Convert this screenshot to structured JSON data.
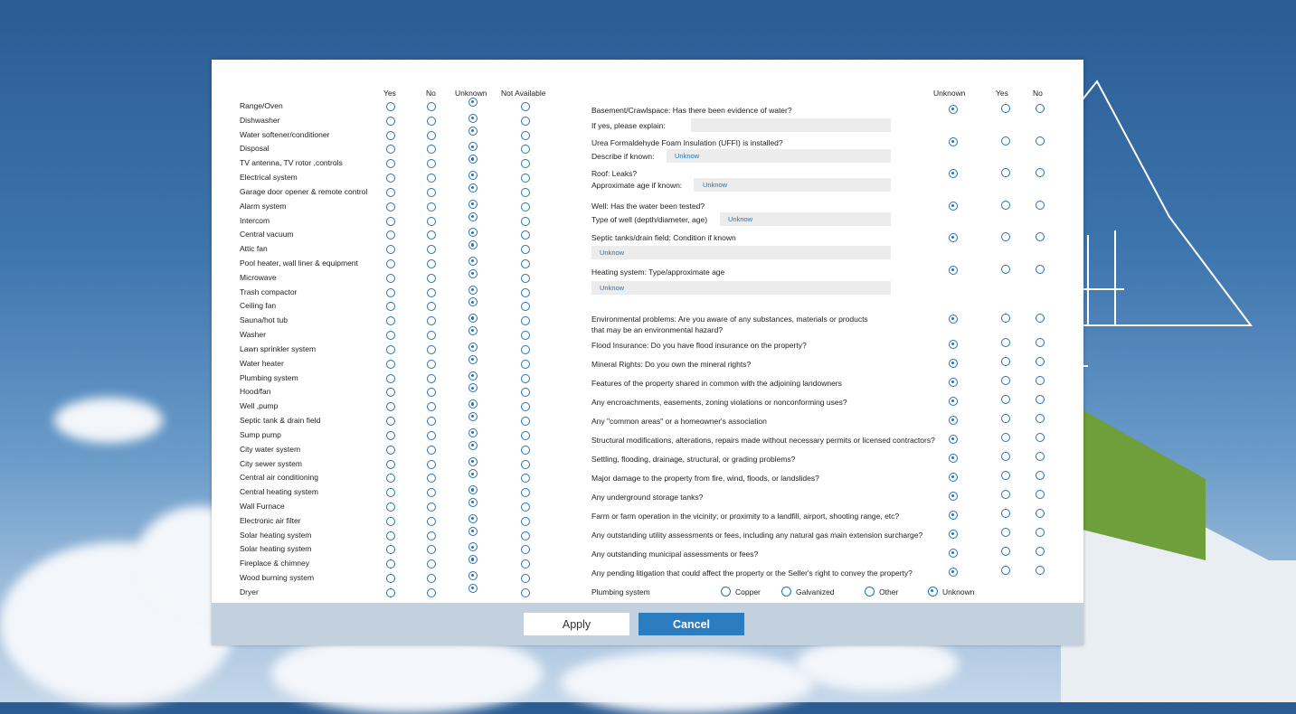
{
  "left_headers": [
    "Yes",
    "No",
    "Unknown",
    "Not Available"
  ],
  "left_items": [
    "Range/Oven",
    "Dishwasher",
    "Water softener/conditioner",
    "Disposal",
    "TV antenna, TV rotor ,controls",
    "Electrical system",
    "Garage door opener & remote control",
    "Alarm system",
    "Intercom",
    "Central vacuum",
    "Attic fan",
    "Pool heater, wall liner & equipment",
    "Microwave",
    "Trash compactor",
    "Ceiling fan",
    "Sauna/hot tub",
    "Washer",
    "Lawn sprinkler system",
    "Water heater",
    "Plumbing system",
    "Hood/fan",
    "Well ,pump",
    "Septic tank & drain field",
    "Sump pump",
    "City water system",
    "City sewer system",
    "Central air conditioning",
    "Central heating system",
    "Wall Furnace",
    "Electronic air filter",
    "Solar heating system",
    "Solar heating system",
    "Fireplace & chimney",
    "Wood burning system",
    "Dryer"
  ],
  "left_selected": "Unknown",
  "right_headers": [
    "Unknown",
    "Yes",
    "No"
  ],
  "right_selected": "Unknown",
  "questions": [
    {
      "text": "Basement/Crawlspace: Has there been evidence of water?"
    },
    {
      "text": "Urea Formaldehyde Foam Insulation (UFFI) is installed?"
    },
    {
      "text": "Roof: Leaks?"
    },
    {
      "text": "Well: Has the water been tested?"
    },
    {
      "text": "Septic tanks/drain field: Condition if known"
    },
    {
      "text": "Heating system: Type/approximate age"
    },
    {
      "text": "Environmental problems: Are you aware of any substances, materials or products"
    },
    {
      "text": "Flood Insurance: Do you have flood insurance on the property?"
    },
    {
      "text": "Mineral Rights: Do you own the mineral rights?"
    },
    {
      "text": "Features of the property shared in common with the adjoining landowners"
    },
    {
      "text": "Any encroachments, easements, zoning violations or nonconforming uses?"
    },
    {
      "text": "Any \"common areas\" or a homeowner's association"
    },
    {
      "text": "Structural modifications, alterations, repairs made without necessary permits or licensed contractors?"
    },
    {
      "text": "Settling, flooding, drainage, structural, or grading problems?"
    },
    {
      "text": "Major damage to the property from fire, wind, floods, or landslides?"
    },
    {
      "text": "Any underground storage tanks?"
    },
    {
      "text": "Farm or farm operation in the vicinity; or proximity to a landfill, airport, shooting range, etc?"
    },
    {
      "text": "Any outstanding utility assessments or fees, including any natural gas main extension surcharge?"
    },
    {
      "text": "Any outstanding municipal assessments or fees?"
    },
    {
      "text": "Any pending litigation that could affect the property or the Seller's right to convey the property?"
    }
  ],
  "sub": {
    "basement_explain_label": "If yes, please explain:",
    "basement_explain_value": "",
    "uffi_label": "Describe if known:",
    "uffi_value": "Unknow",
    "roof_label": "Approximate age if known:",
    "roof_value": "Unknow",
    "well_label": "Type of well (depth/diameter, age)",
    "well_value": "Unknow",
    "septic_value": "Unknow",
    "heating_value": "Unknow",
    "env_line2": "that may be an environmental hazard?"
  },
  "plumbing": {
    "label": "Plumbing system",
    "options": [
      "Copper",
      "Galvanized",
      "Other",
      "Unknown"
    ],
    "selected": "Unknown"
  },
  "buttons": {
    "apply": "Apply",
    "cancel": "Cancel"
  },
  "colors": {
    "radio": "#2272b5",
    "cancel_bg": "#2b7dc0",
    "footer_bg": "#c3d1df"
  }
}
